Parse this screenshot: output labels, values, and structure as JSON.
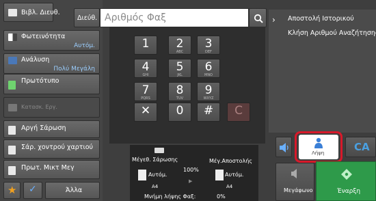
{
  "left_menu": {
    "address_book": "Βιβλ. Διευθ.",
    "brightness": {
      "label": "Φωτεινότητα",
      "value": "Αυτόμ."
    },
    "resolution": {
      "label": "Ανάλυση",
      "value": "Πολύ Μεγάλη"
    },
    "original": "Πρωτότυπο",
    "job_build": "Κατασκ. Εργ.",
    "slow_scan": "Αργή Σάρωση",
    "thick_paper_scan": "Σάρ. χοντρού χαρτιού",
    "mixed_size_original": "Πρωτ. Μικτ Μεγ",
    "others": "Άλλα"
  },
  "top_bar": {
    "address_button": "Διεύθ.",
    "fax_number_placeholder": "Αριθμός Φαξ"
  },
  "keypad": {
    "keys": [
      {
        "digit": "1",
        "sub": ""
      },
      {
        "digit": "2",
        "sub": "ABC"
      },
      {
        "digit": "3",
        "sub": "DEF"
      },
      {
        "digit": "4",
        "sub": "GHI"
      },
      {
        "digit": "5",
        "sub": "JKL"
      },
      {
        "digit": "6",
        "sub": "MNO"
      },
      {
        "digit": "7",
        "sub": "PQRS"
      },
      {
        "digit": "8",
        "sub": "TUV"
      },
      {
        "digit": "9",
        "sub": "WXYZ"
      },
      {
        "digit": "✕",
        "sub": ""
      },
      {
        "digit": "0",
        "sub": ""
      },
      {
        "digit": "#",
        "sub": ""
      }
    ],
    "clear_key": "C"
  },
  "right_panel": {
    "send_history": "Αποστολή Ιστορικού",
    "search_number_call": "Κλήση Αριθμού Αναζήτησης"
  },
  "info_box": {
    "scan_size_label": "Μέγεθ. Σάρωσης",
    "send_size_label": "Μέγ.Αποστολής",
    "scan_size_value": "Αυτόμ.",
    "send_size_value": "Αυτόμ.",
    "scan_paper": "A4",
    "send_paper": "A4",
    "ratio": "100%",
    "fax_memory_label": "Μνήμη λήψης Φαξ:",
    "fax_memory_value": "0%"
  },
  "bottom_right": {
    "receive_label": "Λήψη",
    "ca_label": "CA",
    "speaker_label": "Μεγάφωνο",
    "start_label": "Έναρξη"
  },
  "colors": {
    "accent_blue": "#9ccfff",
    "highlight_red": "#d8192a",
    "start_green": "#2e9a4a",
    "ca_blue": "#4a9fe0"
  }
}
